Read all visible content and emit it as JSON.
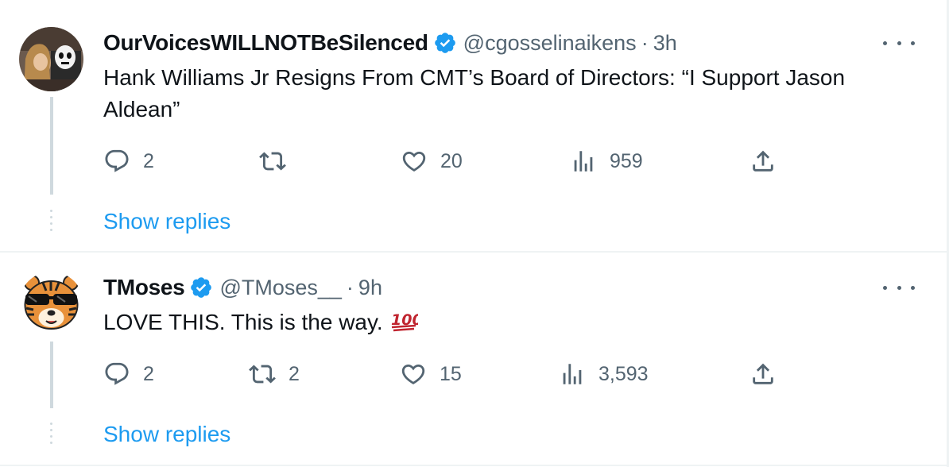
{
  "tweets": [
    {
      "author_name": "OurVoicesWILLNOTBeSilenced",
      "handle": "@cgosselinaikens",
      "separator": "·",
      "time": "3h",
      "text": "Hank Williams Jr Resigns From CMT’s Board of Directors: “I Support Jason Aldean”",
      "actions": {
        "replies": "2",
        "retweets": "",
        "likes": "20",
        "views": "959"
      },
      "show_replies": "Show replies",
      "verified": true
    },
    {
      "author_name": "TMoses",
      "handle": "@TMoses__",
      "separator": "·",
      "time": "9h",
      "text": "LOVE THIS. This is the way.",
      "emoji": "100-emoji",
      "actions": {
        "replies": "2",
        "retweets": "2",
        "likes": "15",
        "views": "3,593"
      },
      "show_replies": "Show replies",
      "verified": true
    }
  ],
  "colors": {
    "accent": "#1d9bf0",
    "secondary_text": "#536471",
    "primary_text": "#0f1419",
    "border": "#eff3f4"
  },
  "icons": [
    "reply-icon",
    "retweet-icon",
    "like-icon",
    "views-icon",
    "share-icon",
    "more-icon",
    "verified-badge-icon"
  ]
}
